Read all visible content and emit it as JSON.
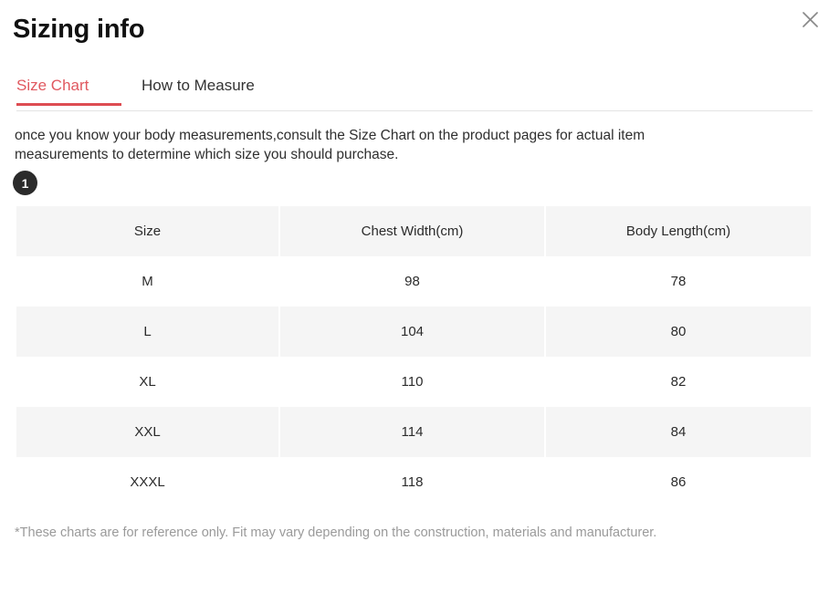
{
  "modal": {
    "title": "Sizing info",
    "close_icon": "close-icon"
  },
  "tabs": [
    {
      "label": "Size Chart",
      "active": true
    },
    {
      "label": "How to Measure",
      "active": false
    }
  ],
  "description": "once you know your body measurements,consult the Size Chart on the product pages for actual item measurements to determine which size you should purchase.",
  "step_badge": "1",
  "table": {
    "columns": [
      "Size",
      "Chest Width(cm)",
      "Body Length(cm)"
    ],
    "rows": [
      [
        "M",
        "98",
        "78"
      ],
      [
        "L",
        "104",
        "80"
      ],
      [
        "XL",
        "110",
        "82"
      ],
      [
        "XXL",
        "114",
        "84"
      ],
      [
        "XXXL",
        "118",
        "86"
      ]
    ]
  },
  "footnote": "*These charts are for reference only. Fit may vary depending on the construction, materials and manufacturer.",
  "colors": {
    "accent": "#dd4c52",
    "tab_active_text": "#e0585f",
    "row_shade": "#f5f5f5",
    "badge_bg": "#2b2b2b",
    "footnote_text": "#9a9a9a"
  }
}
